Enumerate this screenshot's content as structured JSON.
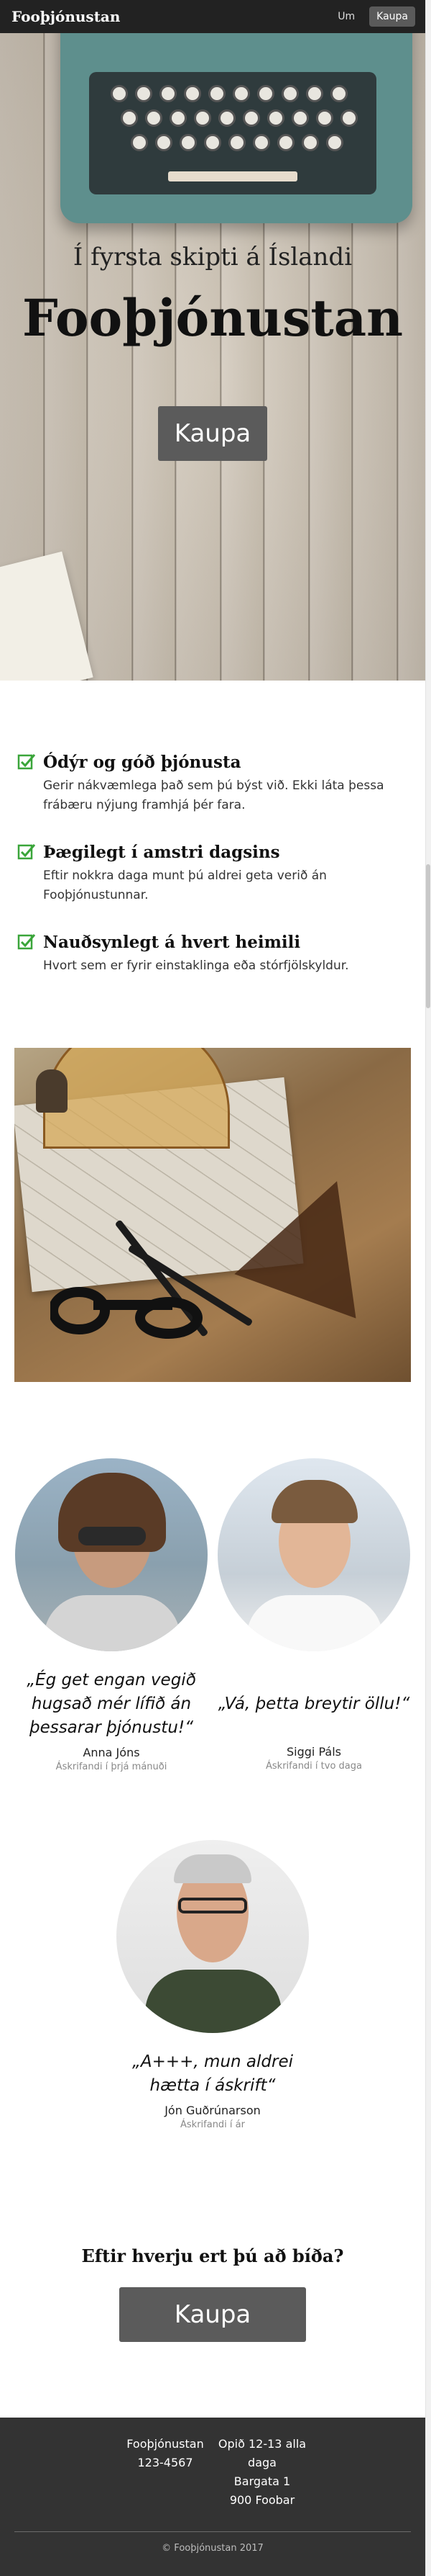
{
  "nav": {
    "brand": "Fooþjónustan",
    "links": [
      {
        "label": "Um"
      },
      {
        "label": "Kaupa"
      }
    ]
  },
  "hero": {
    "subtitle": "Í fyrsta skipti á Íslandi",
    "title": "Fooþjónustan",
    "button": "Kaupa"
  },
  "features": [
    {
      "title": "Ódýr og góð þjónusta",
      "text": "Gerir nákvæmlega það sem þú býst við. Ekki láta þessa frábæru nýjung framhjá þér fara."
    },
    {
      "title": "Þægilegt í amstri dagsins",
      "text": "Eftir nokkra daga munt þú aldrei geta verið án Fooþjónustunnar."
    },
    {
      "title": "Nauðsynlegt á hvert heimili",
      "text": "Hvort sem er fyrir einstaklinga eða stórfjölskyldur."
    }
  ],
  "testimonials": [
    {
      "quote": "„Ég get engan vegið hugsað mér lífið án þessarar þjónustu!“",
      "name": "Anna Jóns",
      "role": "Áskrifandi í þrjá mánuði"
    },
    {
      "quote": "„Vá, þetta breytir öllu!“",
      "name": "Siggi Páls",
      "role": "Áskrifandi í tvo daga"
    },
    {
      "quote": "„A+++, mun aldrei hætta í áskrift“",
      "name": "Jón Guðrúnarson",
      "role": "Áskrifandi í ár"
    }
  ],
  "cta": {
    "title": "Eftir hverju ert þú að bíða?",
    "button": "Kaupa"
  },
  "footer": {
    "company": "Fooþjónustan",
    "phone": "123-4567",
    "hours": "Opið 12-13 alla daga",
    "street": "Bargata 1",
    "postal": "900 Foobar",
    "copyright": "© Fooþjónustan 2017"
  },
  "colors": {
    "accent_green": "#3aa53a",
    "navbar": "#222222",
    "button": "#5b5b5b",
    "footer": "#333333"
  }
}
